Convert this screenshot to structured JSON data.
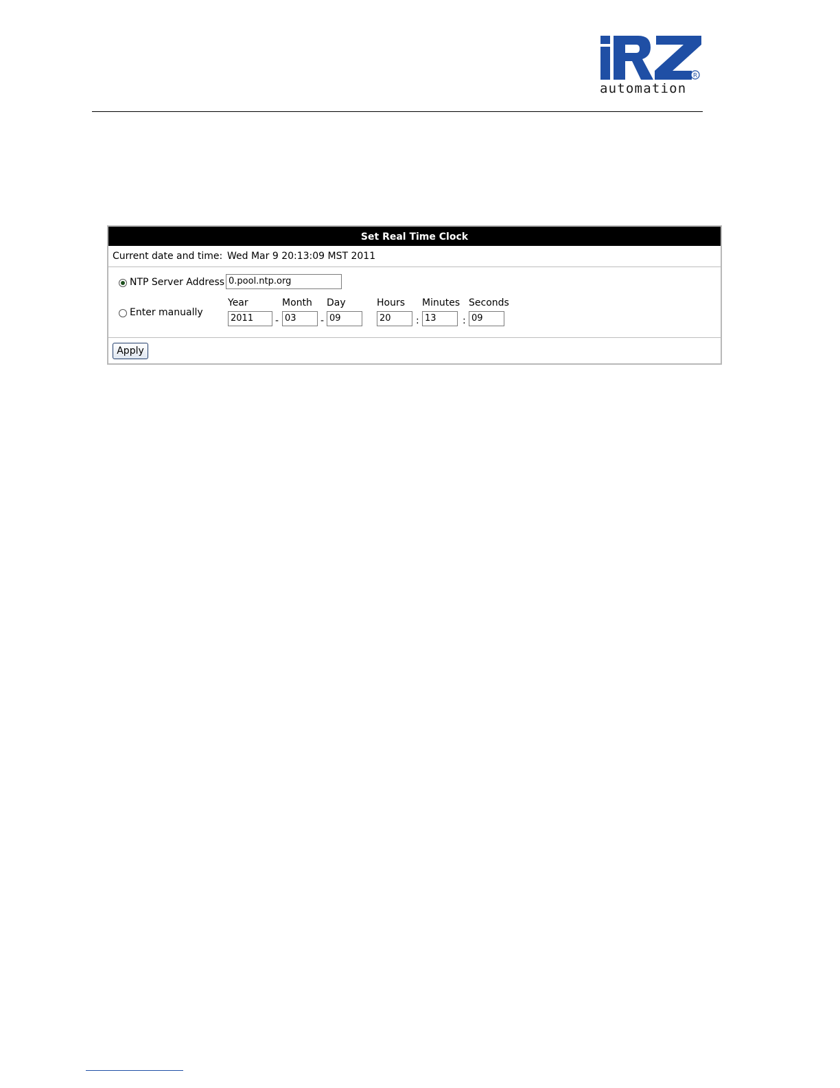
{
  "logo": {
    "wordmark": "iRZ",
    "registered": "®",
    "tagline": "automation",
    "brand_color": "#1f4fa5"
  },
  "panel": {
    "title": "Set Real Time Clock",
    "current": {
      "label": "Current date and time:",
      "value": "Wed Mar 9 20:13:09 MST 2011"
    },
    "ntp": {
      "label": "NTP Server Address",
      "selected": true,
      "value": "0.pool.ntp.org"
    },
    "manual": {
      "label": "Enter manually",
      "selected": false,
      "fields": {
        "year": {
          "label": "Year",
          "value": "2011"
        },
        "month": {
          "label": "Month",
          "value": "03"
        },
        "day": {
          "label": "Day",
          "value": "09"
        },
        "hours": {
          "label": "Hours",
          "value": "20"
        },
        "minutes": {
          "label": "Minutes",
          "value": "13"
        },
        "seconds": {
          "label": "Seconds",
          "value": "09"
        }
      },
      "date_separator": "-",
      "time_separator": ":"
    },
    "apply_label": "Apply"
  }
}
